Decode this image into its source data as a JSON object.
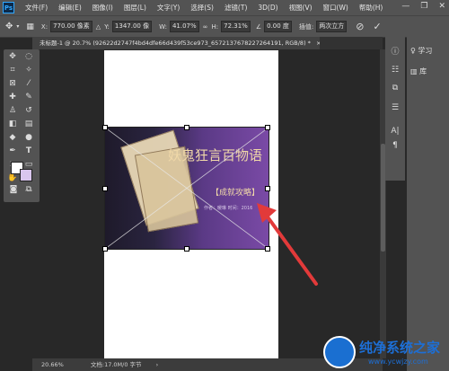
{
  "app": {
    "logo": "Ps"
  },
  "menu": [
    "文件(F)",
    "编辑(E)",
    "图像(I)",
    "图层(L)",
    "文字(Y)",
    "选择(S)",
    "滤镜(T)",
    "3D(D)",
    "视图(V)",
    "窗口(W)",
    "帮助(H)"
  ],
  "window_controls": [
    "—",
    "❐",
    "✕"
  ],
  "options": {
    "x_label": "X:",
    "x_value": "770.00 像素",
    "y_label": "Y:",
    "y_value": "1347.00 像",
    "w_label": "W:",
    "w_value": "41.07%",
    "h_label": "H:",
    "h_value": "72.31%",
    "angle_value": "0.00 度",
    "interp_label": "插值:",
    "interp_value": "两次立方",
    "cancel_icon": "cancel-icon",
    "commit_icon": "check-icon"
  },
  "tab": {
    "title": "未标题-1 @ 20.7% (92622d2747f4bd4dfe66d439f53ce973_6572137678227264191, RGB/8) *",
    "close": "×"
  },
  "status": {
    "zoom": "20.66%",
    "doc": "文档:17.0M/0 字节",
    "arrow": "›"
  },
  "right_panel": {
    "learn": "学习",
    "library": "库"
  },
  "image": {
    "title": "妖鬼狂言百物语",
    "subtitle": "【成就攻略】",
    "small_text": "作者：暖琳    时间：2016",
    "colors": {
      "purple": "#5b3a86",
      "dark": "#241a2c",
      "gold": "#f0d8a8"
    }
  },
  "watermark": {
    "title": "纯净系统之家",
    "url": "www.ycwjzy.com"
  }
}
